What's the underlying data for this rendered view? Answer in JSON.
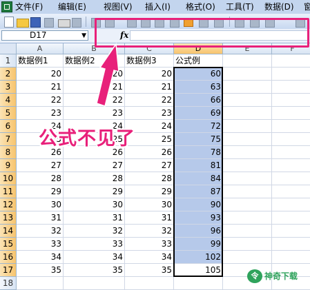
{
  "menu": {
    "items": [
      "文件(F)",
      "编辑(E)",
      "视图(V)",
      "插入(I)",
      "格式(O)",
      "工具(T)",
      "数据(D)",
      "窗"
    ]
  },
  "formula_bar": {
    "name_box": "D17",
    "fx_label": "fx",
    "formula": ""
  },
  "sheet": {
    "column_headers": [
      "A",
      "B",
      "C",
      "D",
      "E",
      "F"
    ],
    "row_headers": [
      "1",
      "2",
      "3",
      "4",
      "5",
      "6",
      "7",
      "8",
      "9",
      "10",
      "11",
      "12",
      "13",
      "14",
      "15",
      "16",
      "17",
      "18"
    ],
    "header_row": [
      "数据例1",
      "数据例2",
      "数据例3",
      "公式例"
    ],
    "rows": [
      [
        "20",
        "20",
        "20",
        "60"
      ],
      [
        "21",
        "21",
        "21",
        "63"
      ],
      [
        "22",
        "22",
        "22",
        "66"
      ],
      [
        "23",
        "23",
        "23",
        "69"
      ],
      [
        "24",
        "24",
        "24",
        "72"
      ],
      [
        "25",
        "25",
        "25",
        "75"
      ],
      [
        "26",
        "26",
        "26",
        "78"
      ],
      [
        "27",
        "27",
        "27",
        "81"
      ],
      [
        "28",
        "28",
        "28",
        "84"
      ],
      [
        "29",
        "29",
        "29",
        "87"
      ],
      [
        "30",
        "30",
        "30",
        "90"
      ],
      [
        "31",
        "31",
        "31",
        "93"
      ],
      [
        "32",
        "32",
        "32",
        "96"
      ],
      [
        "33",
        "33",
        "33",
        "99"
      ],
      [
        "34",
        "34",
        "34",
        "102"
      ],
      [
        "35",
        "35",
        "35",
        "105"
      ]
    ],
    "selected_range": "D2:D17",
    "active_cell": "D17"
  },
  "annotation": {
    "text": "公式不见了",
    "color": "#e8207a"
  },
  "watermark": {
    "logo": "令",
    "text": "神奇下载"
  },
  "colors": {
    "menubar": "#c3d5ee",
    "selection": "#b6c9ea",
    "highlight": "#e8207a",
    "watermark": "#2fa35c"
  }
}
